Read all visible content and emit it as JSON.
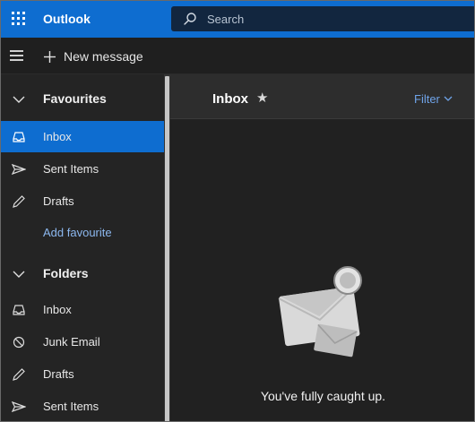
{
  "app": {
    "name": "Outlook"
  },
  "search": {
    "placeholder": "Search"
  },
  "toolbar": {
    "new_message_label": "New message"
  },
  "sidebar": {
    "favourites": {
      "title": "Favourites",
      "items": [
        {
          "label": "Inbox",
          "icon": "inbox-icon",
          "selected": true
        },
        {
          "label": "Sent Items",
          "icon": "send-icon"
        },
        {
          "label": "Drafts",
          "icon": "pencil-icon"
        }
      ],
      "add_label": "Add favourite"
    },
    "folders": {
      "title": "Folders",
      "items": [
        {
          "label": "Inbox",
          "icon": "inbox-icon"
        },
        {
          "label": "Junk Email",
          "icon": "block-icon"
        },
        {
          "label": "Drafts",
          "icon": "pencil-icon"
        },
        {
          "label": "Sent Items",
          "icon": "send-icon"
        }
      ]
    }
  },
  "main": {
    "title": "Inbox",
    "filter_label": "Filter",
    "empty_message": "You've fully caught up."
  },
  "colors": {
    "accent": "#0e6dd0",
    "link": "#6fa3e8",
    "background": "#1b1b1b"
  }
}
